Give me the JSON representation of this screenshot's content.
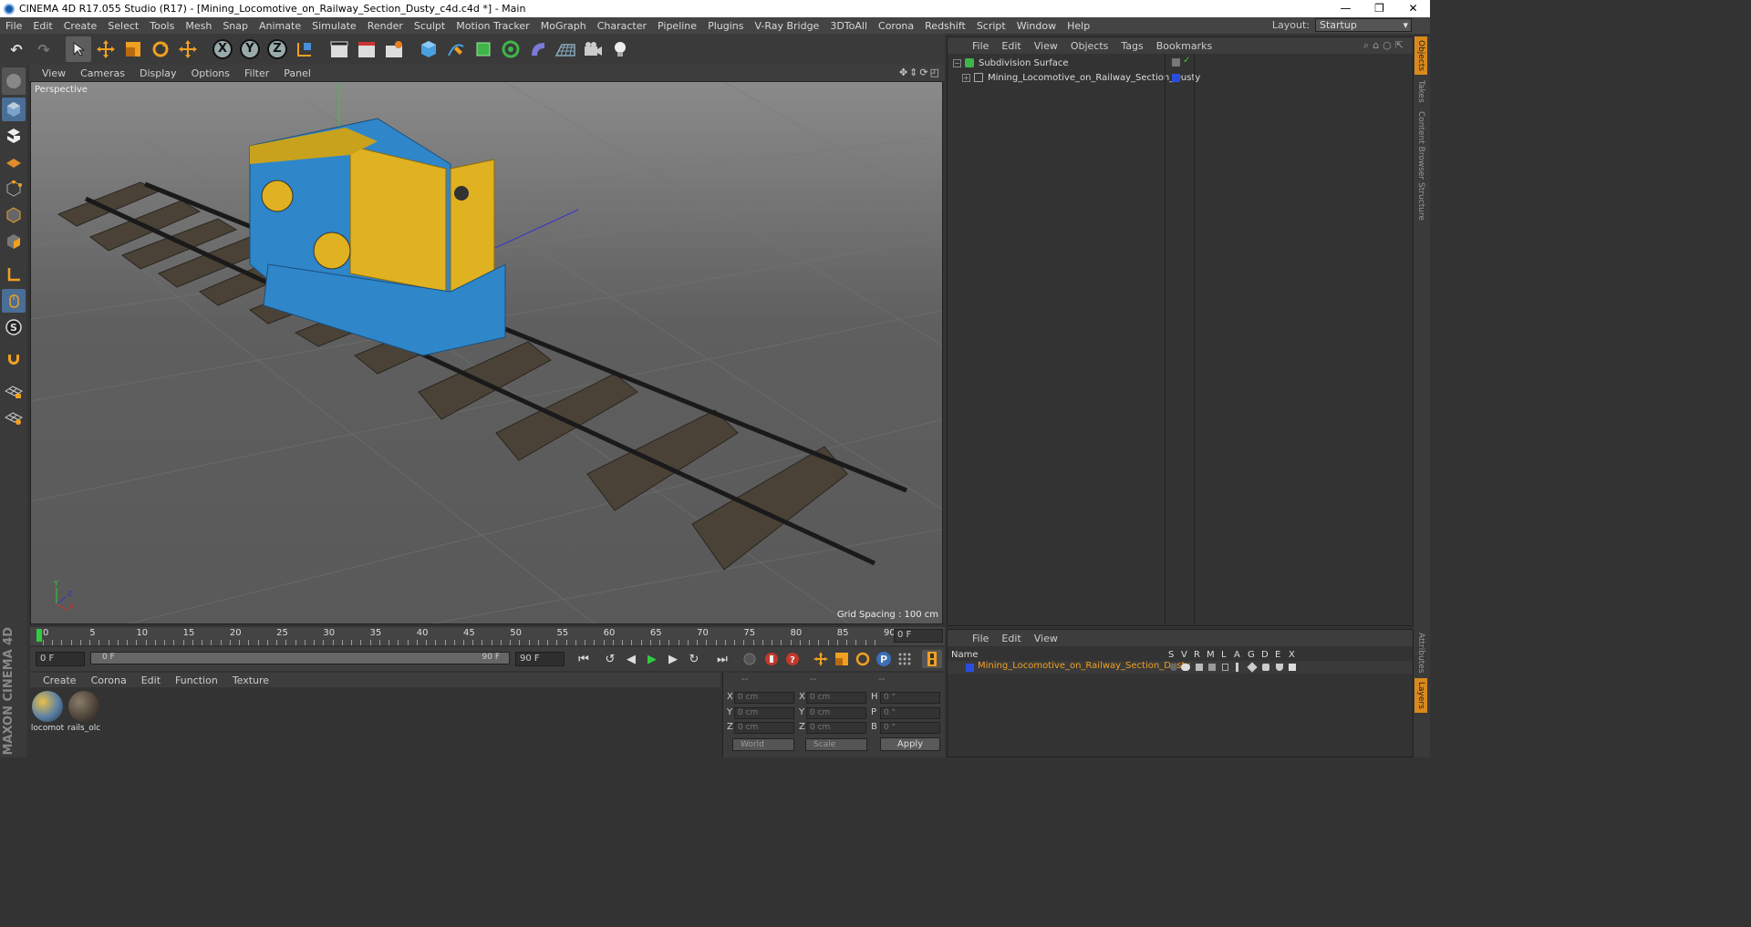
{
  "window": {
    "title": "CINEMA 4D R17.055 Studio (R17) - [Mining_Locomotive_on_Railway_Section_Dusty_c4d.c4d *] - Main",
    "minimize": "—",
    "restore": "❐",
    "close": "✕"
  },
  "menu": {
    "items": [
      "File",
      "Edit",
      "Create",
      "Select",
      "Tools",
      "Mesh",
      "Snap",
      "Animate",
      "Simulate",
      "Render",
      "Sculpt",
      "Motion Tracker",
      "MoGraph",
      "Character",
      "Pipeline",
      "Plugins",
      "V-Ray Bridge",
      "3DToAll",
      "Corona",
      "Redshift",
      "Script",
      "Window",
      "Help"
    ],
    "layout_label": "Layout:",
    "layout_value": "Startup"
  },
  "toolbar": {
    "undo": "↶",
    "redo": "↷",
    "axis_x": "X",
    "axis_y": "Y",
    "axis_z": "Z"
  },
  "viewport": {
    "menu": [
      "View",
      "Cameras",
      "Display",
      "Options",
      "Filter",
      "Panel"
    ],
    "nav_icons": "✥⇕⟳◰",
    "label": "Perspective",
    "grid_spacing": "Grid Spacing : 100 cm",
    "axis_y": "Y",
    "axis_z": "Z",
    "axis_x": "X"
  },
  "timeline": {
    "ticks": [
      "0",
      "5",
      "10",
      "15",
      "20",
      "25",
      "30",
      "35",
      "40",
      "45",
      "50",
      "55",
      "60",
      "65",
      "70",
      "75",
      "80",
      "85",
      "90"
    ],
    "frame_end": "0 F",
    "start_field": "0 F",
    "range_start": "0 F",
    "range_end": "90 F",
    "end_field": "90 F"
  },
  "transport": {
    "goto_start": "⏮",
    "prev_key": "↺",
    "prev_frame": "◀",
    "play": "▶",
    "next_frame": "▶",
    "next_key": "↻",
    "goto_end": "⏭"
  },
  "materials": {
    "menu": [
      "Create",
      "Corona",
      "Edit",
      "Function",
      "Texture"
    ],
    "items": [
      {
        "name": "locomot"
      },
      {
        "name": "rails_olc"
      }
    ]
  },
  "coords": {
    "headers": [
      "--",
      "--",
      "--"
    ],
    "rows": [
      {
        "axis": "X",
        "pos": "0 cm",
        "axis2": "X",
        "size": "0 cm",
        "rot_axis": "H",
        "rot": "0 °"
      },
      {
        "axis": "Y",
        "pos": "0 cm",
        "axis2": "Y",
        "size": "0 cm",
        "rot_axis": "P",
        "rot": "0 °"
      },
      {
        "axis": "Z",
        "pos": "0 cm",
        "axis2": "Z",
        "size": "0 cm",
        "rot_axis": "B",
        "rot": "0 °"
      }
    ],
    "world": "World",
    "scale": "Scale",
    "apply": "Apply"
  },
  "objects": {
    "menu": [
      "File",
      "Edit",
      "View",
      "Objects",
      "Tags",
      "Bookmarks"
    ],
    "search_icons": "⌕⌂○⇱",
    "items": [
      {
        "name": "Subdivision Surface"
      },
      {
        "name": "Mining_Locomotive_on_Railway_Section_Dusty"
      }
    ]
  },
  "layers": {
    "menu": [
      "File",
      "Edit",
      "View"
    ],
    "columns": [
      "Name",
      "S",
      "V",
      "R",
      "M",
      "L",
      "A",
      "G",
      "D",
      "E",
      "X"
    ],
    "row_name": "Mining_Locomotive_on_Railway_Section_Dusty"
  },
  "right_tabs": [
    "Objects",
    "Takes",
    "Content Browser",
    "Structure",
    "Attributes",
    "Layers"
  ],
  "maxon": "MAXON CINEMA 4D",
  "colors": {
    "accent_orange": "#d9891c",
    "layer_name": "#f0a020",
    "layer_color": "#2a4de0",
    "play_green": "#2ecc40"
  }
}
